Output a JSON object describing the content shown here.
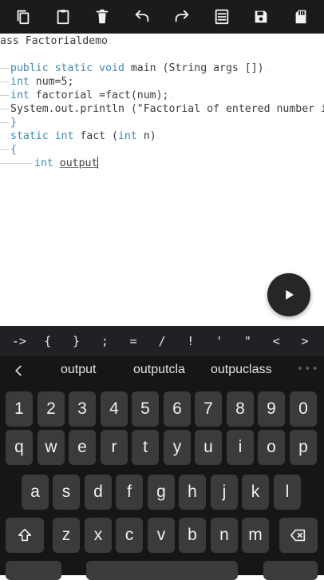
{
  "toolbar": {
    "icons": [
      "copy-icon",
      "clipboard-icon",
      "delete-icon",
      "undo-icon",
      "redo-icon",
      "select-all-icon",
      "save-icon",
      "sd-card-icon"
    ]
  },
  "editor": {
    "lines": [
      {
        "text": "ass Factorialdemo",
        "suffix": "."
      },
      {
        "text": "",
        "suffix": ""
      },
      {
        "kw": "public static void",
        "rest": " main (String args [])",
        "suffix": "."
      },
      {
        "kw": "int",
        "rest": " num=5;",
        "suffix": ""
      },
      {
        "kw": "int",
        "rest": " factorial =fact(num);",
        "suffix": "."
      },
      {
        "kw": "",
        "rest": "System.out.println (\"Factorial of entered number is:",
        "suffix": ""
      },
      {
        "kw": "",
        "rest": "}",
        "suffix": ""
      },
      {
        "kw": "static int",
        "rest": " fact (",
        "kw2": "int",
        "rest2": " n)",
        "suffix": "."
      },
      {
        "kw": "",
        "rest": "{",
        "suffix": ""
      },
      {
        "kw": "int",
        "rest": " ",
        "typed": "output"
      }
    ]
  },
  "symbol_bar": [
    "->",
    "{",
    "}",
    ";",
    "=",
    "/",
    "!",
    "'",
    "\"",
    "<",
    ">"
  ],
  "suggestions": [
    "output",
    "outputcla",
    "outpuclass"
  ],
  "keyboard": {
    "row_numbers": [
      "1",
      "2",
      "3",
      "4",
      "5",
      "6",
      "7",
      "8",
      "9",
      "0"
    ],
    "row1": [
      "q",
      "w",
      "e",
      "r",
      "t",
      "y",
      "u",
      "i",
      "o",
      "p"
    ],
    "row2": [
      "a",
      "s",
      "d",
      "f",
      "g",
      "h",
      "j",
      "k",
      "l"
    ],
    "row3": [
      "z",
      "x",
      "c",
      "v",
      "b",
      "n",
      "m"
    ]
  },
  "colors": {
    "keyword": "#3d8ab0",
    "toolbar_bg": "#1b1b1d",
    "keyboard_bg": "#161616",
    "key_bg": "#3b3b3d"
  }
}
